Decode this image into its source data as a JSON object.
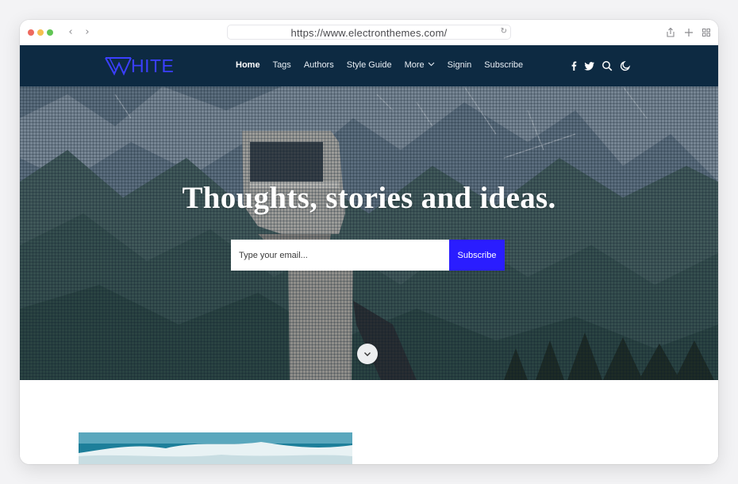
{
  "browser": {
    "url": "https://www.electronthemes.com/",
    "icons": [
      "back-icon",
      "forward-icon",
      "reload-icon",
      "share-icon",
      "new-tab-icon",
      "tab-grid-icon"
    ]
  },
  "site": {
    "logo_text": "HITE",
    "nav": [
      {
        "label": "Home",
        "active": true
      },
      {
        "label": "Tags"
      },
      {
        "label": "Authors"
      },
      {
        "label": "Style Guide"
      },
      {
        "label": "More"
      },
      {
        "label": "Signin"
      },
      {
        "label": "Subscribe"
      }
    ],
    "social_icons": [
      "facebook-icon",
      "twitter-icon",
      "search-icon",
      "dark-mode-icon"
    ]
  },
  "hero": {
    "headline": "Thoughts, stories and ideas.",
    "email_placeholder": "Type your email...",
    "subscribe_label": "Subscribe"
  },
  "colors": {
    "header_bg": "#0d2a42",
    "accent": "#2a1dff",
    "logo": "#3b3fff"
  }
}
